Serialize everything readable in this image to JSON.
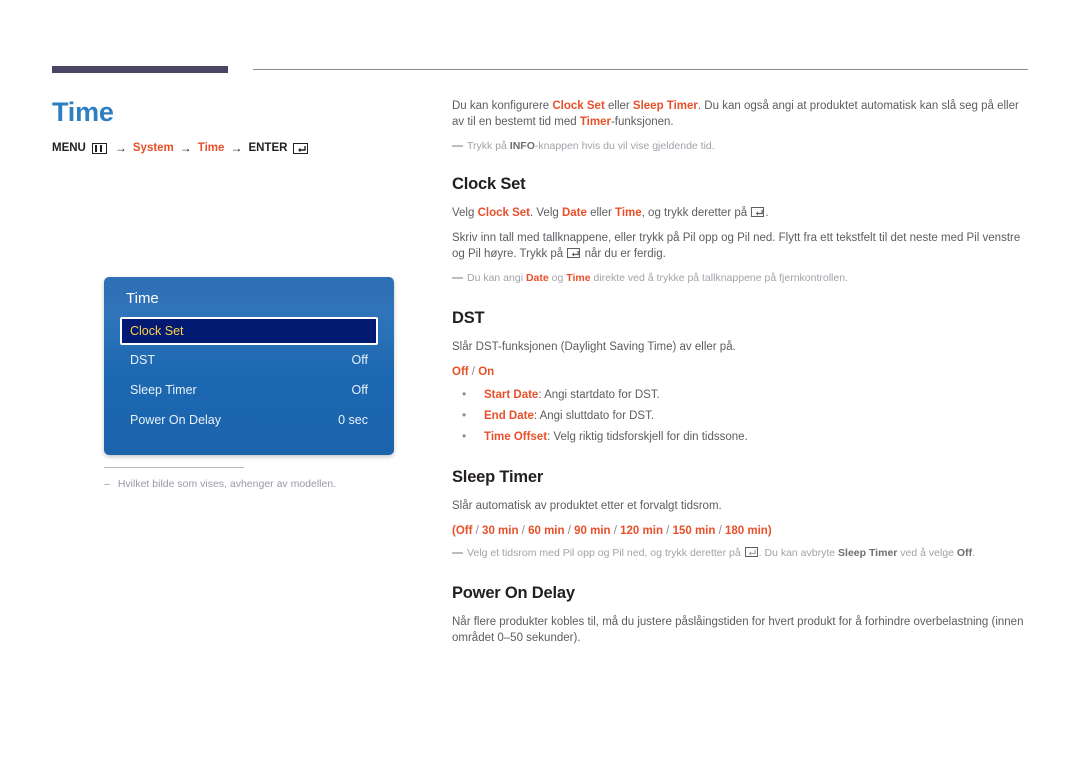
{
  "page": {
    "title": "Time"
  },
  "menu_path": {
    "menu_label": "MENU",
    "menu_icon": "menu-grid-icon",
    "arrow": "→",
    "step1": "System",
    "step2": "Time",
    "enter_label": "ENTER",
    "enter_icon": "enter-key-icon"
  },
  "osd": {
    "title": "Time",
    "rows": [
      {
        "label": "Clock Set",
        "value": "",
        "selected": true
      },
      {
        "label": "DST",
        "value": "Off",
        "selected": false
      },
      {
        "label": "Sleep Timer",
        "value": "Off",
        "selected": false
      },
      {
        "label": "Power On Delay",
        "value": "0 sec",
        "selected": false
      }
    ]
  },
  "caption": {
    "dash": "–",
    "text": "Hvilket bilde som vises, avhenger av modellen."
  },
  "intro": {
    "p1_a": "Du kan konfigurere ",
    "p1_b": "Clock Set",
    "p1_c": " eller ",
    "p1_d": "Sleep Timer",
    "p1_e": ". Du kan også angi at produktet automatisk kan slå seg på eller av til en bestemt tid med ",
    "p1_f": "Timer",
    "p1_g": "-funksjonen.",
    "note_a": "Trykk på ",
    "note_b": "INFO",
    "note_c": "-knappen hvis du vil vise gjeldende tid."
  },
  "clock_set": {
    "heading": "Clock Set",
    "p1_a": "Velg ",
    "p1_b": "Clock Set",
    "p1_c": ". Velg ",
    "p1_d": "Date",
    "p1_e": " eller ",
    "p1_f": "Time",
    "p1_g": ", og trykk deretter på ",
    "p1_h": ".",
    "p2_a": "Skriv inn tall med tallknappene, eller trykk på Pil opp og Pil ned. Flytt fra ett tekstfelt til det neste med Pil venstre og Pil høyre. Trykk på ",
    "p2_b": " når du er ferdig.",
    "note_a": "Du kan angi ",
    "note_b": "Date",
    "note_c": " og ",
    "note_d": "Time",
    "note_e": " direkte ved å trykke på tallknappene på fjernkontrollen."
  },
  "dst": {
    "heading": "DST",
    "p1": "Slår DST-funksjonen (Daylight Saving Time) av eller på.",
    "options": [
      "Off",
      "On"
    ],
    "options_separator": " / ",
    "bullets": [
      {
        "term": "Start Date",
        "desc": ": Angi startdato for DST."
      },
      {
        "term": "End Date",
        "desc": ": Angi sluttdato for DST."
      },
      {
        "term": "Time Offset",
        "desc": ": Velg riktig tidsforskjell for din tidssone."
      }
    ]
  },
  "sleep_timer": {
    "heading": "Sleep Timer",
    "p1": "Slår automatisk av produktet etter et forvalgt tidsrom.",
    "options_open": "(",
    "options": [
      "Off",
      "30 min",
      "60 min",
      "90 min",
      "120 min",
      "150 min",
      "180 min"
    ],
    "options_separator": " / ",
    "options_close": ")",
    "note_a": "Velg et tidsrom med Pil opp og Pil ned, og trykk deretter på ",
    "note_b": ". Du kan avbryte ",
    "note_c": "Sleep Timer",
    "note_d": " ved å velge ",
    "note_e": "Off",
    "note_f": "."
  },
  "power_on_delay": {
    "heading": "Power On Delay",
    "p1": "Når flere produkter kobles til, må du justere påslåingstiden for hvert produkt for å forhindre overbelastning (innen området 0–50 sekunder)."
  },
  "colors": {
    "accent_orange": "#e8502a",
    "title_blue": "#2e7ec0",
    "rule_purple": "#4b4463",
    "osd_blue": "#1f6ab3",
    "osd_selected_bg": "#031a73",
    "osd_selected_text": "#ffd24a"
  }
}
